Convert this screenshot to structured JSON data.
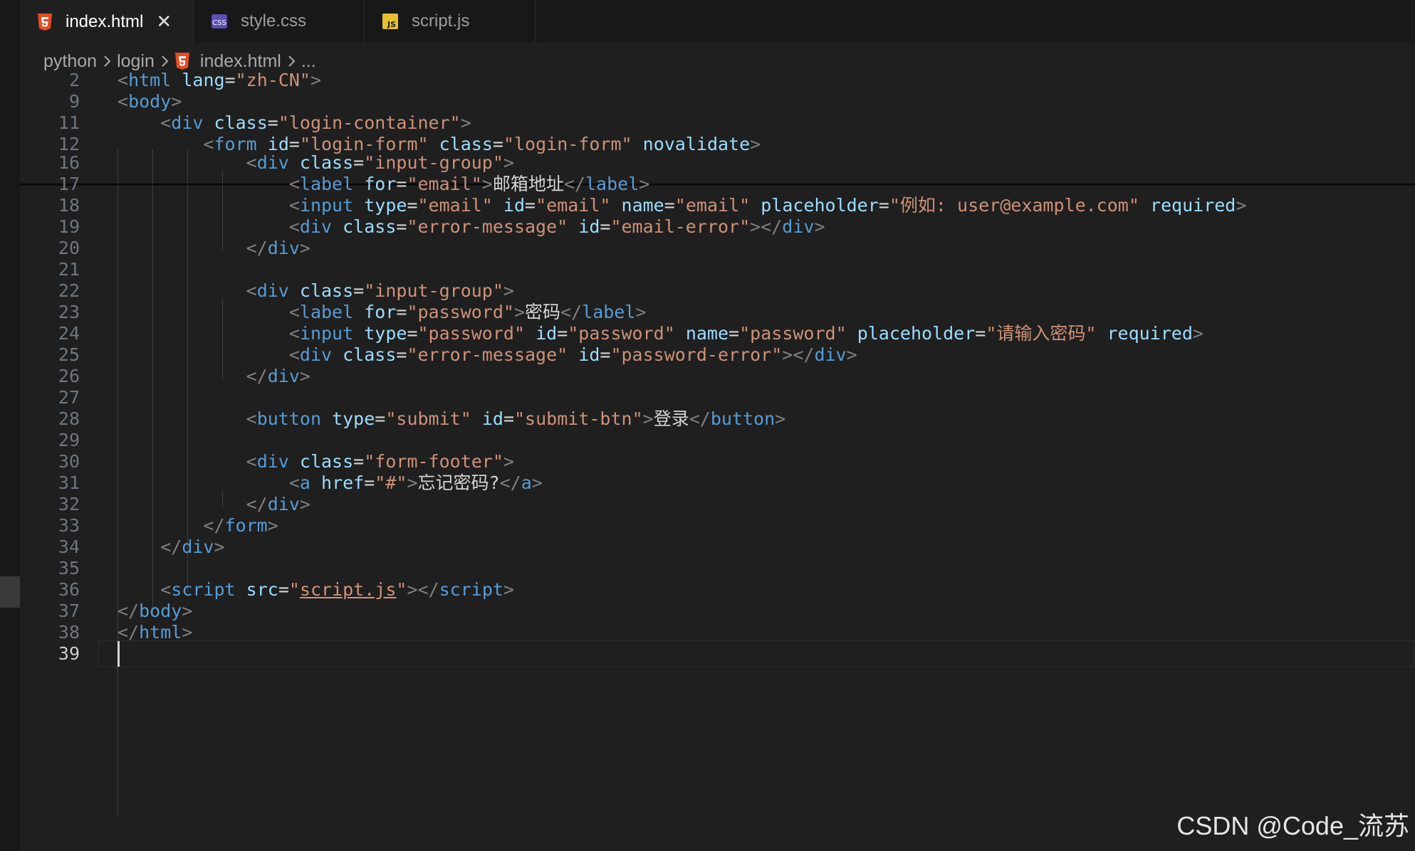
{
  "tabs": [
    {
      "label": "index.html",
      "icon": "html5-icon",
      "active": true,
      "close": "✕"
    },
    {
      "label": "style.css",
      "icon": "css-icon",
      "active": false
    },
    {
      "label": "script.js",
      "icon": "javascript-icon",
      "active": false
    }
  ],
  "breadcrumb": {
    "items": [
      "python",
      "login",
      "index.html",
      "..."
    ]
  },
  "colors": {
    "tag": "#569cd6",
    "attr": "#9cdcfe",
    "value": "#ce9178",
    "punct": "#808080",
    "text": "#d4d4d4",
    "html_icon": "#e44d26",
    "js_icon": "#e5c02f",
    "css_icon": "#5b4fb3"
  },
  "sticky": [
    {
      "n": "2",
      "tokens": [
        [
          "p",
          "<"
        ],
        [
          "tag",
          "html"
        ],
        [
          "txt",
          " "
        ],
        [
          "attr",
          "lang"
        ],
        [
          "txt",
          "="
        ],
        [
          "val",
          "\"zh-CN\""
        ],
        [
          "p",
          ">"
        ]
      ]
    },
    {
      "n": "9",
      "tokens": [
        [
          "p",
          "<"
        ],
        [
          "tag",
          "body"
        ],
        [
          "p",
          ">"
        ]
      ]
    },
    {
      "n": "11",
      "tokens": [
        [
          "txt",
          "    "
        ],
        [
          "p",
          "<"
        ],
        [
          "tag",
          "div"
        ],
        [
          "txt",
          " "
        ],
        [
          "attr",
          "class"
        ],
        [
          "txt",
          "="
        ],
        [
          "val",
          "\"login-container\""
        ],
        [
          "p",
          ">"
        ]
      ]
    },
    {
      "n": "12",
      "tokens": [
        [
          "txt",
          "        "
        ],
        [
          "p",
          "<"
        ],
        [
          "tag",
          "form"
        ],
        [
          "txt",
          " "
        ],
        [
          "attr",
          "id"
        ],
        [
          "txt",
          "="
        ],
        [
          "val",
          "\"login-form\""
        ],
        [
          "txt",
          " "
        ],
        [
          "attr",
          "class"
        ],
        [
          "txt",
          "="
        ],
        [
          "val",
          "\"login-form\""
        ],
        [
          "txt",
          " "
        ],
        [
          "attr",
          "novalidate"
        ],
        [
          "p",
          ">"
        ]
      ]
    }
  ],
  "lines": [
    {
      "n": "16",
      "tokens": [
        [
          "txt",
          "            "
        ],
        [
          "p",
          "<"
        ],
        [
          "tag",
          "div"
        ],
        [
          "txt",
          " "
        ],
        [
          "attr",
          "class"
        ],
        [
          "txt",
          "="
        ],
        [
          "val",
          "\"input-group\""
        ],
        [
          "p",
          ">"
        ]
      ]
    },
    {
      "n": "17",
      "tokens": [
        [
          "txt",
          "                "
        ],
        [
          "p",
          "<"
        ],
        [
          "tag",
          "label"
        ],
        [
          "txt",
          " "
        ],
        [
          "attr",
          "for"
        ],
        [
          "txt",
          "="
        ],
        [
          "val",
          "\"email\""
        ],
        [
          "p",
          ">"
        ],
        [
          "txt",
          "邮箱地址"
        ],
        [
          "p",
          "</"
        ],
        [
          "tag",
          "label"
        ],
        [
          "p",
          ">"
        ]
      ]
    },
    {
      "n": "18",
      "tokens": [
        [
          "txt",
          "                "
        ],
        [
          "p",
          "<"
        ],
        [
          "tag",
          "input"
        ],
        [
          "txt",
          " "
        ],
        [
          "attr",
          "type"
        ],
        [
          "txt",
          "="
        ],
        [
          "val",
          "\"email\""
        ],
        [
          "txt",
          " "
        ],
        [
          "attr",
          "id"
        ],
        [
          "txt",
          "="
        ],
        [
          "val",
          "\"email\""
        ],
        [
          "txt",
          " "
        ],
        [
          "attr",
          "name"
        ],
        [
          "txt",
          "="
        ],
        [
          "val",
          "\"email\""
        ],
        [
          "txt",
          " "
        ],
        [
          "attr",
          "placeholder"
        ],
        [
          "txt",
          "="
        ],
        [
          "val",
          "\"例如: user@example.com\""
        ],
        [
          "txt",
          " "
        ],
        [
          "attr",
          "required"
        ],
        [
          "p",
          ">"
        ]
      ]
    },
    {
      "n": "19",
      "tokens": [
        [
          "txt",
          "                "
        ],
        [
          "p",
          "<"
        ],
        [
          "tag",
          "div"
        ],
        [
          "txt",
          " "
        ],
        [
          "attr",
          "class"
        ],
        [
          "txt",
          "="
        ],
        [
          "val",
          "\"error-message\""
        ],
        [
          "txt",
          " "
        ],
        [
          "attr",
          "id"
        ],
        [
          "txt",
          "="
        ],
        [
          "val",
          "\"email-error\""
        ],
        [
          "p",
          "></"
        ],
        [
          "tag",
          "div"
        ],
        [
          "p",
          ">"
        ]
      ]
    },
    {
      "n": "20",
      "tokens": [
        [
          "txt",
          "            "
        ],
        [
          "p",
          "</"
        ],
        [
          "tag",
          "div"
        ],
        [
          "p",
          ">"
        ]
      ]
    },
    {
      "n": "21",
      "tokens": []
    },
    {
      "n": "22",
      "tokens": [
        [
          "txt",
          "            "
        ],
        [
          "p",
          "<"
        ],
        [
          "tag",
          "div"
        ],
        [
          "txt",
          " "
        ],
        [
          "attr",
          "class"
        ],
        [
          "txt",
          "="
        ],
        [
          "val",
          "\"input-group\""
        ],
        [
          "p",
          ">"
        ]
      ]
    },
    {
      "n": "23",
      "tokens": [
        [
          "txt",
          "                "
        ],
        [
          "p",
          "<"
        ],
        [
          "tag",
          "label"
        ],
        [
          "txt",
          " "
        ],
        [
          "attr",
          "for"
        ],
        [
          "txt",
          "="
        ],
        [
          "val",
          "\"password\""
        ],
        [
          "p",
          ">"
        ],
        [
          "txt",
          "密码"
        ],
        [
          "p",
          "</"
        ],
        [
          "tag",
          "label"
        ],
        [
          "p",
          ">"
        ]
      ]
    },
    {
      "n": "24",
      "tokens": [
        [
          "txt",
          "                "
        ],
        [
          "p",
          "<"
        ],
        [
          "tag",
          "input"
        ],
        [
          "txt",
          " "
        ],
        [
          "attr",
          "type"
        ],
        [
          "txt",
          "="
        ],
        [
          "val",
          "\"password\""
        ],
        [
          "txt",
          " "
        ],
        [
          "attr",
          "id"
        ],
        [
          "txt",
          "="
        ],
        [
          "val",
          "\"password\""
        ],
        [
          "txt",
          " "
        ],
        [
          "attr",
          "name"
        ],
        [
          "txt",
          "="
        ],
        [
          "val",
          "\"password\""
        ],
        [
          "txt",
          " "
        ],
        [
          "attr",
          "placeholder"
        ],
        [
          "txt",
          "="
        ],
        [
          "val",
          "\"请输入密码\""
        ],
        [
          "txt",
          " "
        ],
        [
          "attr",
          "required"
        ],
        [
          "p",
          ">"
        ]
      ]
    },
    {
      "n": "25",
      "tokens": [
        [
          "txt",
          "                "
        ],
        [
          "p",
          "<"
        ],
        [
          "tag",
          "div"
        ],
        [
          "txt",
          " "
        ],
        [
          "attr",
          "class"
        ],
        [
          "txt",
          "="
        ],
        [
          "val",
          "\"error-message\""
        ],
        [
          "txt",
          " "
        ],
        [
          "attr",
          "id"
        ],
        [
          "txt",
          "="
        ],
        [
          "val",
          "\"password-error\""
        ],
        [
          "p",
          "></"
        ],
        [
          "tag",
          "div"
        ],
        [
          "p",
          ">"
        ]
      ]
    },
    {
      "n": "26",
      "tokens": [
        [
          "txt",
          "            "
        ],
        [
          "p",
          "</"
        ],
        [
          "tag",
          "div"
        ],
        [
          "p",
          ">"
        ]
      ]
    },
    {
      "n": "27",
      "tokens": []
    },
    {
      "n": "28",
      "tokens": [
        [
          "txt",
          "            "
        ],
        [
          "p",
          "<"
        ],
        [
          "tag",
          "button"
        ],
        [
          "txt",
          " "
        ],
        [
          "attr",
          "type"
        ],
        [
          "txt",
          "="
        ],
        [
          "val",
          "\"submit\""
        ],
        [
          "txt",
          " "
        ],
        [
          "attr",
          "id"
        ],
        [
          "txt",
          "="
        ],
        [
          "val",
          "\"submit-btn\""
        ],
        [
          "p",
          ">"
        ],
        [
          "txt",
          "登录"
        ],
        [
          "p",
          "</"
        ],
        [
          "tag",
          "button"
        ],
        [
          "p",
          ">"
        ]
      ]
    },
    {
      "n": "29",
      "tokens": []
    },
    {
      "n": "30",
      "tokens": [
        [
          "txt",
          "            "
        ],
        [
          "p",
          "<"
        ],
        [
          "tag",
          "div"
        ],
        [
          "txt",
          " "
        ],
        [
          "attr",
          "class"
        ],
        [
          "txt",
          "="
        ],
        [
          "val",
          "\"form-footer\""
        ],
        [
          "p",
          ">"
        ]
      ]
    },
    {
      "n": "31",
      "tokens": [
        [
          "txt",
          "                "
        ],
        [
          "p",
          "<"
        ],
        [
          "tag",
          "a"
        ],
        [
          "txt",
          " "
        ],
        [
          "attr",
          "href"
        ],
        [
          "txt",
          "="
        ],
        [
          "val",
          "\"#\""
        ],
        [
          "p",
          ">"
        ],
        [
          "txt",
          "忘记密码?"
        ],
        [
          "p",
          "</"
        ],
        [
          "tag",
          "a"
        ],
        [
          "p",
          ">"
        ]
      ]
    },
    {
      "n": "32",
      "tokens": [
        [
          "txt",
          "            "
        ],
        [
          "p",
          "</"
        ],
        [
          "tag",
          "div"
        ],
        [
          "p",
          ">"
        ]
      ]
    },
    {
      "n": "33",
      "tokens": [
        [
          "txt",
          "        "
        ],
        [
          "p",
          "</"
        ],
        [
          "tag",
          "form"
        ],
        [
          "p",
          ">"
        ]
      ]
    },
    {
      "n": "34",
      "tokens": [
        [
          "txt",
          "    "
        ],
        [
          "p",
          "</"
        ],
        [
          "tag",
          "div"
        ],
        [
          "p",
          ">"
        ]
      ]
    },
    {
      "n": "35",
      "tokens": []
    },
    {
      "n": "36",
      "tokens": [
        [
          "txt",
          "    "
        ],
        [
          "p",
          "<"
        ],
        [
          "tag",
          "script"
        ],
        [
          "txt",
          " "
        ],
        [
          "attr",
          "src"
        ],
        [
          "txt",
          "="
        ],
        [
          "val",
          "\""
        ],
        [
          "link",
          "script.js"
        ],
        [
          "val",
          "\""
        ],
        [
          "p",
          "></"
        ],
        [
          "tag",
          "script"
        ],
        [
          "p",
          ">"
        ]
      ]
    },
    {
      "n": "37",
      "tokens": [
        [
          "p",
          "</"
        ],
        [
          "tag",
          "body"
        ],
        [
          "p",
          ">"
        ]
      ]
    },
    {
      "n": "38",
      "tokens": [
        [
          "p",
          "</"
        ],
        [
          "tag",
          "html"
        ],
        [
          "p",
          ">"
        ]
      ]
    },
    {
      "n": "39",
      "tokens": [],
      "current": true
    }
  ],
  "watermark": "CSDN @Code_流苏"
}
